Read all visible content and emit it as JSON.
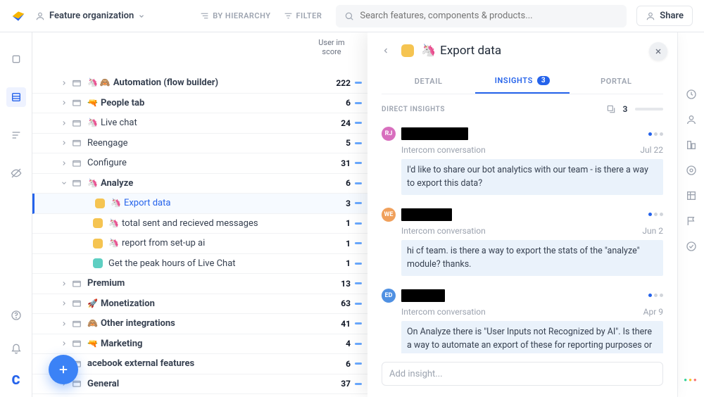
{
  "header": {
    "workspace": "Feature organization",
    "view_by": "BY HIERARCHY",
    "filter": "FILTER",
    "search_placeholder": "Search features, components & products...",
    "share": "Share"
  },
  "columns": {
    "score_header_l1": "User im",
    "score_header_l2": "score"
  },
  "features": [
    {
      "title": "Automation (flow builder)",
      "emoji": "🦄 🙈",
      "bold": true,
      "score": 222,
      "type": "folder"
    },
    {
      "title": "People tab",
      "emoji": "🔫",
      "bold": true,
      "score": 6,
      "type": "folder"
    },
    {
      "title": "Live chat",
      "emoji": "🦄",
      "bold": false,
      "score": 24,
      "type": "folder"
    },
    {
      "title": "Reengage",
      "emoji": "",
      "bold": false,
      "score": 5,
      "type": "folder"
    },
    {
      "title": "Configure",
      "emoji": "",
      "bold": false,
      "score": 31,
      "type": "folder"
    },
    {
      "title": "Analyze",
      "emoji": "🦄",
      "bold": true,
      "score": 6,
      "type": "folder",
      "expanded": true,
      "children": [
        {
          "title": "Export data",
          "emoji": "🦄",
          "score": 3,
          "color": "yellow",
          "selected": true
        },
        {
          "title": "total sent and recieved messages",
          "emoji": "🦄",
          "score": 1,
          "color": "yellow"
        },
        {
          "title": "report from set-up ai",
          "emoji": "🦄",
          "score": 1,
          "color": "yellow"
        },
        {
          "title": "Get the peak hours of Live Chat",
          "emoji": "",
          "score": 1,
          "color": "teal"
        }
      ]
    },
    {
      "title": "Premium",
      "emoji": "",
      "bold": true,
      "score": 13,
      "type": "folder"
    },
    {
      "title": "Monetization",
      "emoji": "🚀",
      "bold": true,
      "score": 63,
      "type": "folder"
    },
    {
      "title": "Other integrations",
      "emoji": "🙈",
      "bold": true,
      "score": 41,
      "type": "folder"
    },
    {
      "title": "Marketing",
      "emoji": "🔫",
      "bold": true,
      "score": 4,
      "type": "folder"
    },
    {
      "title": "acebook external features",
      "emoji": "",
      "bold": true,
      "score": 6,
      "type": "folder"
    },
    {
      "title": "General",
      "emoji": "",
      "bold": true,
      "score": 37,
      "type": "folder"
    }
  ],
  "panel": {
    "title": "Export data",
    "emoji": "🦄",
    "tabs": {
      "detail": "DETAIL",
      "insights": "INSIGHTS",
      "insights_count": "3",
      "portal": "PORTAL",
      "active": "insights"
    },
    "direct_label": "DIRECT INSIGHTS",
    "direct_count": "3",
    "insights": [
      {
        "avatar": "RJ",
        "avatar_color": "#d86fbe",
        "name_width": 95,
        "source": "Intercom conversation",
        "date": "Jul 22",
        "message": "I'd like to share our bot analytics with our team - is there a way to export this data?"
      },
      {
        "avatar": "WE",
        "avatar_color": "#f0a05b",
        "name_width": 72,
        "source": "Intercom conversation",
        "date": "Jun 2",
        "message": "hi cf team. is there a way to export the stats of the \"analyze\" module? thanks."
      },
      {
        "avatar": "ED",
        "avatar_color": "#4f90e2",
        "name_width": 62,
        "source": "Intercom conversation",
        "date": "Apr 9",
        "message": "On Analyze there is \"User Inputs not Recognized by AI\". Is there a way to automate an export of these for reporting purposes or access this data anywhere else?"
      }
    ],
    "add_placeholder": "Add insight..."
  }
}
